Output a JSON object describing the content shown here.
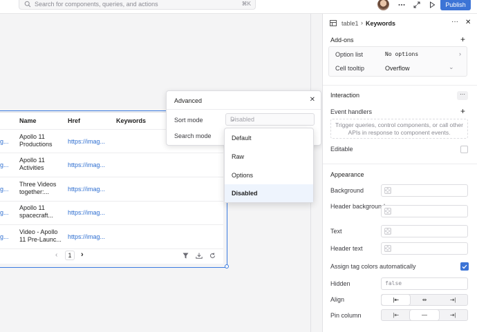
{
  "topbar": {
    "search_placeholder": "Search for components, queries, and actions",
    "shortcut": "⌘K",
    "publish_label": "Publish",
    "accent": "#3c74d6"
  },
  "table": {
    "headers": [
      "Name",
      "Href",
      "Keywords"
    ],
    "rows": [
      {
        "left": "g...",
        "name": "Apollo 11 Productions",
        "href": "https://imag..."
      },
      {
        "left": "g...",
        "name": "Apollo 11 Activities",
        "href": "https://imag..."
      },
      {
        "left": "g...",
        "name": "Three Videos together:...",
        "href": "https://imag..."
      },
      {
        "left": "g...",
        "name": "Apollo 11 spacecraft...",
        "href": "https://imag..."
      },
      {
        "left": "g...",
        "name": "Video - Apollo 11 Pre-Launc...",
        "href": "https://imag..."
      }
    ],
    "page": "1"
  },
  "advanced": {
    "title": "Advanced",
    "sort_label": "Sort mode",
    "sort_value": "Disabled",
    "search_label": "Search mode",
    "options": [
      "Default",
      "Raw",
      "Options",
      "Disabled"
    ],
    "selected": "Disabled"
  },
  "inspector": {
    "component": "table1",
    "column": "Keywords",
    "addons_title": "Add-ons",
    "option_list_label": "Option list",
    "option_list_value": "No options",
    "cell_tooltip_label": "Cell tooltip",
    "cell_tooltip_value": "Overflow",
    "interaction_title": "Interaction",
    "event_handlers_label": "Event handlers",
    "event_handlers_hint": "Trigger queries, control components, or call other APIs in response to component events.",
    "editable_label": "Editable",
    "appearance_title": "Appearance",
    "background_label": "Background",
    "header_background_label": "Header background",
    "text_label": "Text",
    "header_text_label": "Header text",
    "assign_tag_label": "Assign tag colors automatically",
    "hidden_label": "Hidden",
    "hidden_value": "false",
    "align_label": "Align",
    "pin_label": "Pin column"
  }
}
